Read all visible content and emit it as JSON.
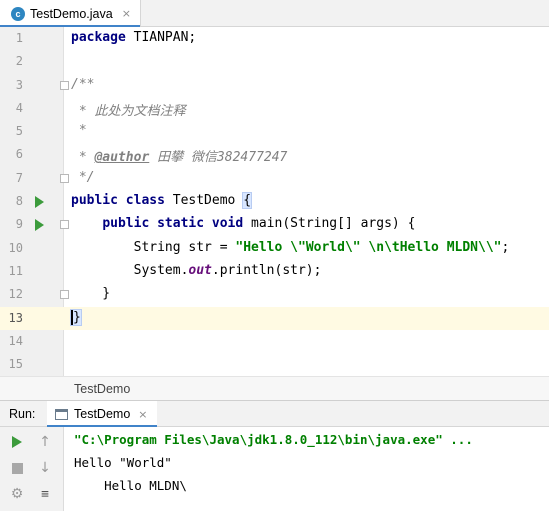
{
  "editor_tab": {
    "label": "TestDemo.java",
    "icon": "c",
    "close": "×"
  },
  "editor": {
    "line_numbers": [
      "1",
      "2",
      "3",
      "4",
      "5",
      "6",
      "7",
      "8",
      "9",
      "10",
      "11",
      "12",
      "13",
      "14",
      "15"
    ],
    "code": {
      "l1_kw": "package",
      "l1_rest": " TIANPAN;",
      "l3": "/**",
      "l4": " * 此处为文档注释",
      "l5": " *",
      "l6_pre": " * ",
      "l6_tag": "@author",
      "l6_rest": " 田攀 微信382477247",
      "l7": " */",
      "l8_kw": "public class",
      "l8_rest": " TestDemo ",
      "l8_brace": "{",
      "l9_indent": "    ",
      "l9_kw": "public static void",
      "l9_rest": " main(String[] args) {",
      "l10_pre": "        String str = ",
      "l10_str": "\"Hello \\\"World\\\" \\n\\tHello MLDN\\\\\"",
      "l10_post": ";",
      "l11_pre": "        System.",
      "l11_field": "out",
      "l11_post": ".println(str);",
      "l12": "    }",
      "l13": "}"
    }
  },
  "breadcrumb": {
    "item": "TestDemo"
  },
  "run_panel": {
    "title": "Run:",
    "tab_label": "TestDemo",
    "tab_close": "×",
    "console": [
      "\"C:\\Program Files\\Java\\jdk1.8.0_112\\bin\\java.exe\" ...",
      "Hello \"World\"",
      "    Hello MLDN\\"
    ]
  },
  "colors": {
    "keyword": "#000080",
    "string": "#008000",
    "comment": "#808080",
    "field": "#660e7a",
    "current_line": "#fffae3",
    "run_green": "#3c9b3c",
    "tab_accent": "#4083c9"
  },
  "icons": {
    "file_tab": "java-class-icon",
    "gutter_run": "run-gutter-icon",
    "rerun": "rerun-icon",
    "stop": "stop-icon",
    "up": "arrow-up-icon",
    "down": "arrow-down-icon",
    "settings": "gear-icon",
    "wrap": "soft-wrap-icon",
    "console": "console-icon"
  }
}
